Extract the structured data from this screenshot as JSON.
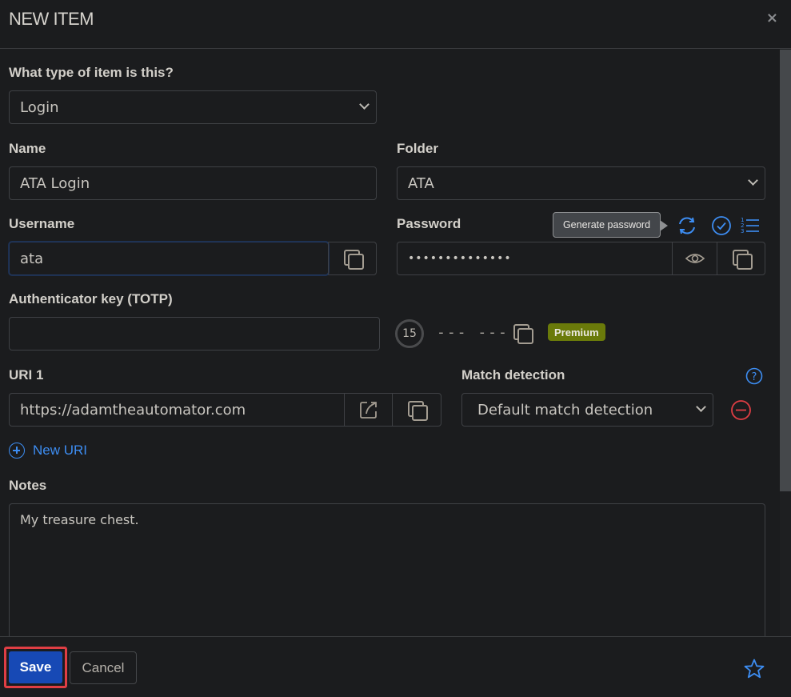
{
  "dialog": {
    "title": "NEW ITEM",
    "close_label": "×"
  },
  "form": {
    "type_label": "What type of item is this?",
    "type_value": "Login",
    "name_label": "Name",
    "name_value": "ATA Login",
    "folder_label": "Folder",
    "folder_value": "ATA",
    "username_label": "Username",
    "username_value": "ata",
    "password_label": "Password",
    "password_value": "••••••••••••••",
    "tooltip_text": "Generate password",
    "totp_label": "Authenticator key (TOTP)",
    "totp_value": "",
    "totp_timer": "15",
    "totp_code": "--- ---",
    "premium_badge": "Premium",
    "uri_label": "URI 1",
    "uri_value": "https://adamtheautomator.com",
    "match_label": "Match detection",
    "match_value": "Default match detection",
    "new_uri_label": "New URI",
    "notes_label": "Notes",
    "notes_value": "My treasure chest."
  },
  "footer": {
    "save_label": "Save",
    "cancel_label": "Cancel"
  },
  "colors": {
    "accent": "#3d8df2",
    "save_bg": "#1749b5",
    "danger": "#e03e44",
    "premium": "#6a7a0a",
    "background": "#1b1c1e"
  }
}
